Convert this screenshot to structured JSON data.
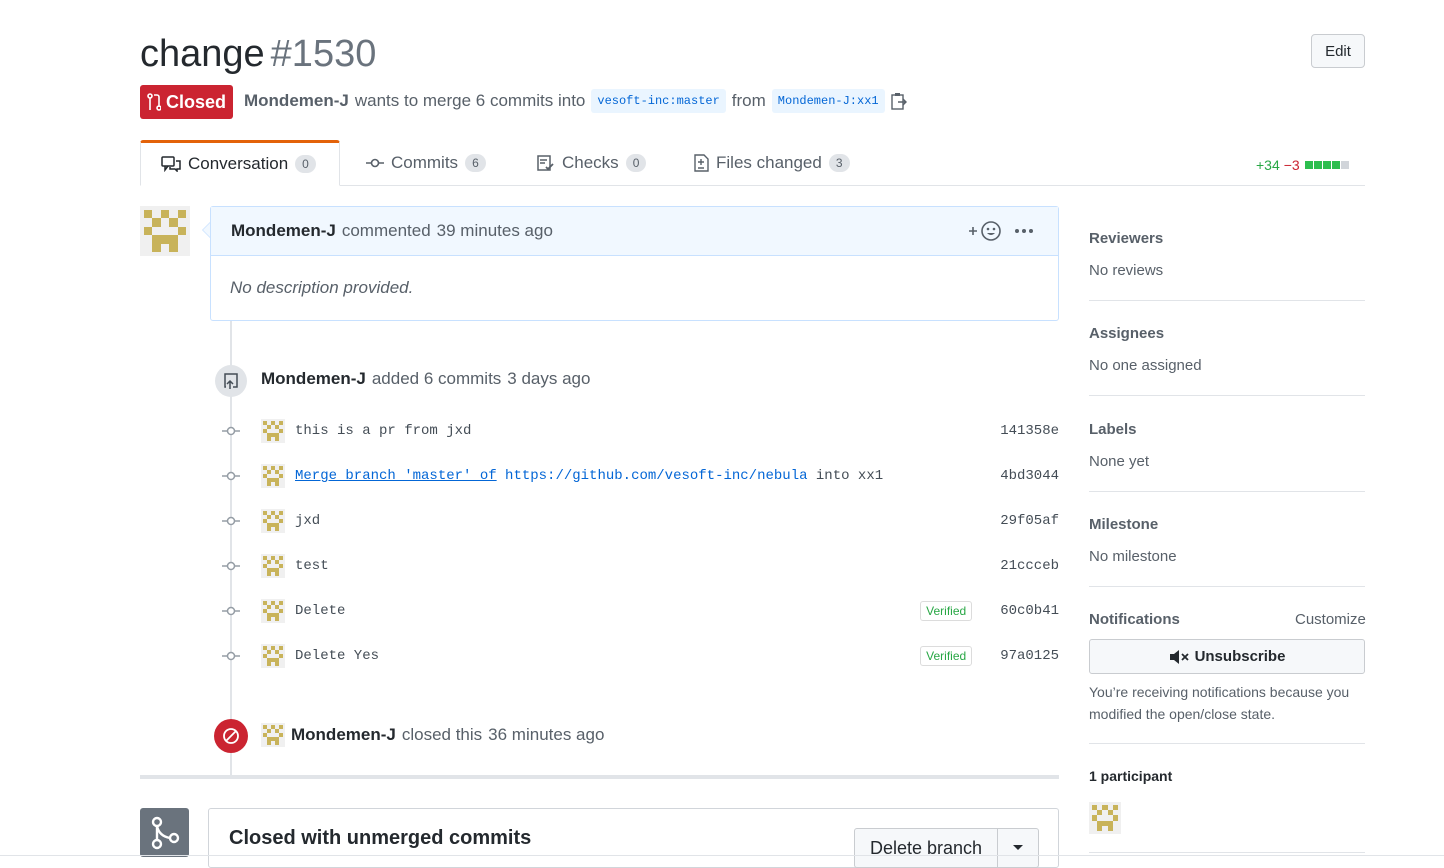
{
  "header": {
    "title": "change",
    "number": "#1530",
    "edit_label": "Edit",
    "state_label": "Closed",
    "author": "Mondemen-J",
    "merge_text": "wants to merge 6 commits into",
    "base_ref": "vesoft-inc:master",
    "from_text": "from",
    "head_ref": "Mondemen-J:xx1"
  },
  "tabs": [
    {
      "label": "Conversation",
      "count": "0",
      "icon": "comment-discussion-icon"
    },
    {
      "label": "Commits",
      "count": "6",
      "icon": "git-commit-icon"
    },
    {
      "label": "Checks",
      "count": "0",
      "icon": "checklist-icon"
    },
    {
      "label": "Files changed",
      "count": "3",
      "icon": "file-diff-icon"
    }
  ],
  "diffstat": {
    "additions": "+34",
    "deletions": "−3"
  },
  "comment": {
    "author": "Mondemen-J",
    "action": "commented",
    "time": "39 minutes ago",
    "body": "No description provided."
  },
  "commits_event": {
    "author": "Mondemen-J",
    "text": "added 6 commits",
    "time": "3 days ago"
  },
  "commits": [
    {
      "message": "this is a pr from jxd",
      "sha": "141358e",
      "verified": ""
    },
    {
      "message_link": "Merge branch 'master' of",
      "message_url": "https://github.com/vesoft-inc/nebula",
      "message_suffix": "into xx1",
      "sha": "4bd3044",
      "verified": ""
    },
    {
      "message": "jxd",
      "sha": "29f05af",
      "verified": ""
    },
    {
      "message": "test",
      "sha": "21ccceb",
      "verified": ""
    },
    {
      "message": "Delete",
      "sha": "60c0b41",
      "verified": "Verified"
    },
    {
      "message": "Delete Yes",
      "sha": "97a0125",
      "verified": "Verified"
    }
  ],
  "closed_event": {
    "author": "Mondemen-J",
    "text": "closed this",
    "time": "36 minutes ago"
  },
  "merge_box": {
    "title": "Closed with unmerged commits",
    "delete_branch_label": "Delete branch"
  },
  "sidebar": {
    "reviewers": {
      "title": "Reviewers",
      "value": "No reviews"
    },
    "assignees": {
      "title": "Assignees",
      "value": "No one assigned"
    },
    "labels": {
      "title": "Labels",
      "value": "None yet"
    },
    "milestone": {
      "title": "Milestone",
      "value": "No milestone"
    },
    "notifications": {
      "title": "Notifications",
      "customize": "Customize",
      "button": "Unsubscribe",
      "reason": "You’re receiving notifications because you modified the open/close state."
    },
    "participants": {
      "title": "1 participant"
    }
  },
  "colors": {
    "closed_red": "#cb2431",
    "link_blue": "#0366d6",
    "green": "#28a745",
    "avatar_olive": "#c8b35a"
  }
}
